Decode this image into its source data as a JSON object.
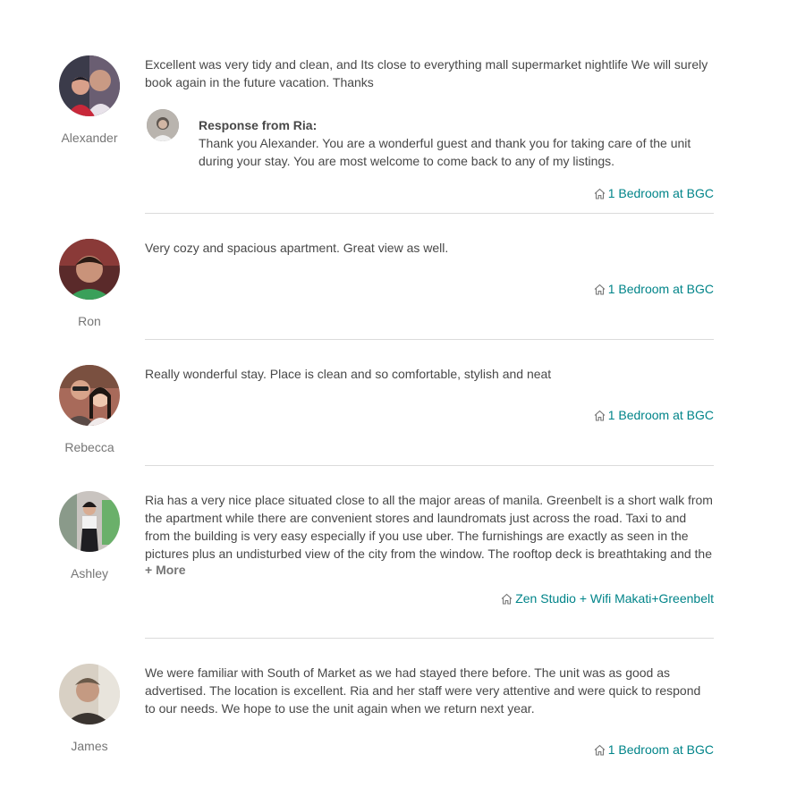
{
  "reviews": [
    {
      "author": "Alexander",
      "text": "Excellent was very tidy and clean, and Its close to everything mall supermarket nightlife We will surely book again in the future vacation. Thanks",
      "response": {
        "title": "Response from Ria:",
        "text": "Thank you Alexander. You are a wonderful guest and thank you for taking care of the unit during your stay. You are most welcome to come back to any of my listings."
      },
      "listing": "1 Bedroom at BGC"
    },
    {
      "author": "Ron",
      "text": "Very cozy and spacious apartment. Great view as well.",
      "listing": "1 Bedroom at BGC"
    },
    {
      "author": "Rebecca",
      "text": "Really wonderful stay. Place is clean and so comfortable, stylish and neat",
      "listing": "1 Bedroom at BGC"
    },
    {
      "author": "Ashley",
      "text": "Ria has a very nice place situated close to all the major areas of manila. Greenbelt is a short walk from the apartment while there are convenient stores and laundromats just across the road. Taxi to and from the building is very easy especially if you use uber. The furnishings are exactly as seen in the pictures plus an undisturbed view of the city from the window. The rooftop deck is breathtaking and the building's facilities are modern and spacious enough to accommodate the peak periods of",
      "more_label": "+ More",
      "listing": "Zen Studio + Wifi Makati+Greenbelt"
    },
    {
      "author": "James",
      "text": "We were familiar with South of Market as we had stayed there before. The unit was as good as advertised. The location is excellent. Ria and her staff were very attentive and were quick to respond to our needs. We hope to use the unit again when we return next year.",
      "listing": "1 Bedroom at BGC"
    }
  ],
  "icons": {
    "listing": "home-icon"
  },
  "colors": {
    "link": "#008489",
    "text": "#484848",
    "muted": "#767676",
    "divider": "#dbdbdb"
  }
}
